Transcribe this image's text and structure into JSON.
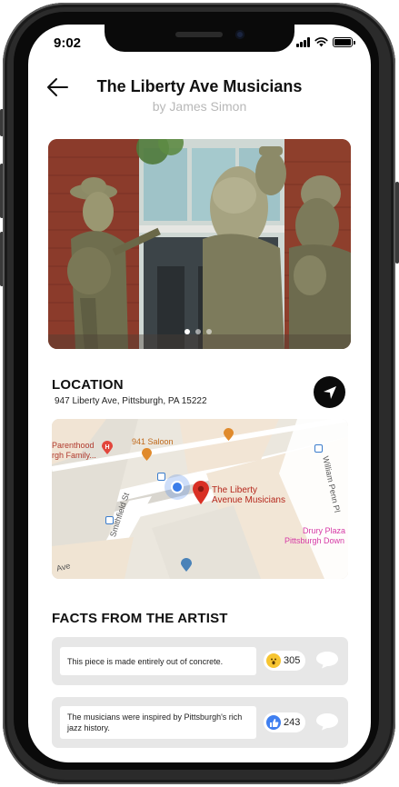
{
  "status": {
    "time": "9:02"
  },
  "header": {
    "title": "The Liberty Ave Musicians",
    "subtitle": "by James Simon"
  },
  "gallery": {
    "slide_count": 3,
    "active_index": 0
  },
  "location": {
    "heading": "LOCATION",
    "address": "947 Liberty Ave, Pittsburgh, PA 15222"
  },
  "map": {
    "labels": {
      "parenthood_1": "Parenthood",
      "parenthood_2": "rgh Family...",
      "saloon": "941 Saloon",
      "pin_1": "The Liberty",
      "pin_2": "Avenue Musicians",
      "drury_1": "Drury Plaza",
      "drury_2": "Pittsburgh Down",
      "smithfield": "Smithfield St",
      "william": "William Penn Pl",
      "ave": "Ave"
    },
    "pin_color": "#d93025",
    "location_dot_color": "#3b7de9"
  },
  "facts": {
    "heading": "FACTS FROM THE ARTIST",
    "items": [
      {
        "text": "This piece is made entirely out of concrete.",
        "reaction_icon": "surprised-face-icon",
        "count": "305"
      },
      {
        "text": "The musicians were inspired by Pittsburgh's rich jazz history.",
        "reaction_icon": "thumbs-up-icon",
        "count": "243"
      }
    ]
  }
}
